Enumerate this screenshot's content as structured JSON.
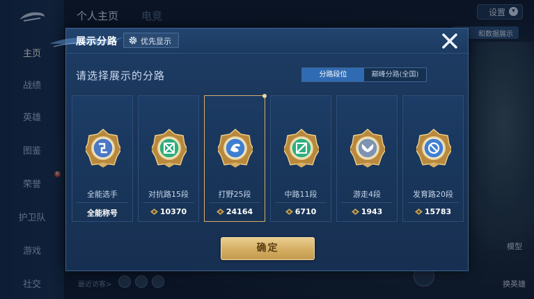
{
  "background": {
    "sidebar_items": [
      "主页",
      "战绩",
      "英雄",
      "图鉴",
      "荣誉",
      "护卫队",
      "游戏",
      "社交"
    ],
    "sidebar_badges": {
      "荣誉": "新"
    },
    "top_tabs": [
      "个人主页",
      "电竞"
    ],
    "settings_label": "设置",
    "top_right_pill": "和数据展示",
    "right_labels": [
      "模型",
      "换英雄"
    ],
    "bottom_visitors_label": "最近访客>"
  },
  "modal": {
    "title": "展示分路",
    "priority_button": "优先显示",
    "subtitle": "请选择展示的分路",
    "segments": [
      {
        "label": "分路段位",
        "active": true
      },
      {
        "label": "巅峰分路(全国)",
        "active": false
      }
    ],
    "cards": [
      {
        "name": "全能选手",
        "score": "全能称号",
        "show_diamond": false,
        "selected": false,
        "badge": "all-round-badge-icon",
        "badge_color": "#4a78c4",
        "glyph": "swirl"
      },
      {
        "name": "对抗路15段",
        "score": "10370",
        "show_diamond": true,
        "selected": false,
        "badge": "clash-lane-badge-icon",
        "badge_color": "#2fae7d",
        "glyph": "cross"
      },
      {
        "name": "打野25段",
        "score": "24164",
        "show_diamond": true,
        "selected": true,
        "badge": "jungle-badge-icon",
        "badge_color": "#3f7fd1",
        "glyph": "dragon"
      },
      {
        "name": "中路11段",
        "score": "6710",
        "show_diamond": true,
        "selected": false,
        "badge": "mid-lane-badge-icon",
        "badge_color": "#2fae7d",
        "glyph": "slash"
      },
      {
        "name": "游走4段",
        "score": "1943",
        "show_diamond": true,
        "selected": false,
        "badge": "roam-badge-icon",
        "badge_color": "#7d93b3",
        "glyph": "wings"
      },
      {
        "name": "发育路20段",
        "score": "15783",
        "show_diamond": true,
        "selected": false,
        "badge": "farm-lane-badge-icon",
        "badge_color": "#3f7fd1",
        "glyph": "ban"
      }
    ],
    "confirm_button": "确定"
  },
  "colors": {
    "gold": "#d4ae62",
    "modal_bg": "#1a3558",
    "accent_blue": "#2f6bb3",
    "selected_border": "#d9ae6e"
  }
}
